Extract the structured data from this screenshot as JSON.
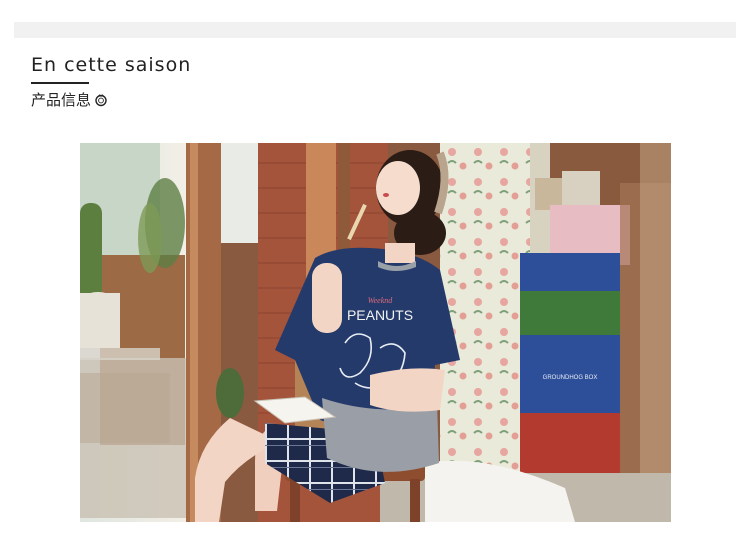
{
  "section": {
    "title": "En cette saison",
    "subtitle": "产品信息",
    "subtitle_icon": "ring-icon"
  },
  "photo": {
    "shirt_text_small": "Weeknd",
    "shirt_text_large": "PEANUTS",
    "box_text": "GROUNDHOG BOX"
  },
  "colors": {
    "shirt": "#243a6b",
    "plaid": "#1f2a4a",
    "brick": "#a4543a",
    "crate_blue": "#2d4f9a",
    "crate_green": "#3f7a3a",
    "crate_red": "#b33a2f"
  }
}
